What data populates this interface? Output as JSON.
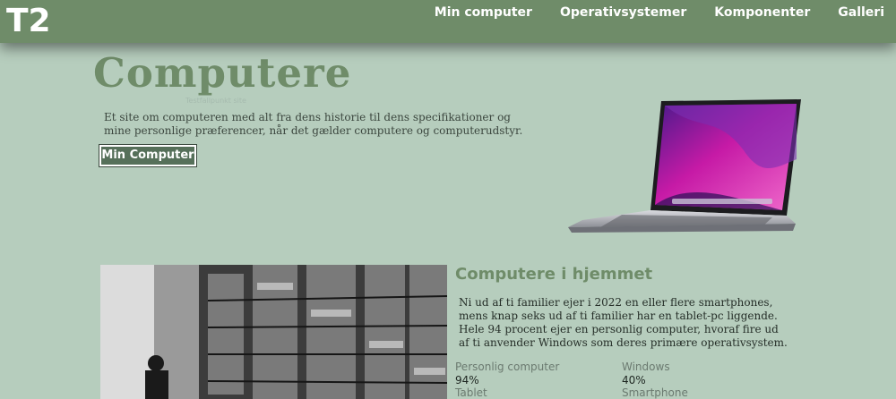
{
  "header": {
    "logo": "T2",
    "nav": [
      {
        "label": "Min computer"
      },
      {
        "label": "Operativsystemer"
      },
      {
        "label": "Komponenter"
      },
      {
        "label": "Galleri"
      }
    ]
  },
  "hero": {
    "title": "Computere",
    "subtitle_small": "Testfallpunkt site",
    "text": "Et site om computeren med alt fra dens historie til dens specifikationer og mine personlige præferencer, når det gælder computere og computerudstyr.",
    "button_label": "Min Computer"
  },
  "section": {
    "title": "Computere i hjemmet",
    "text": "Ni ud af ti familier ejer i 2022 en eller flere smartphones, mens knap seks ud af ti familier har en tablet-pc liggende. Hele 94 procent ejer en personlig computer, hvoraf fire ud af ti anvender Windows som deres primære operativsystem.",
    "stats": [
      {
        "label": "Personlig computer",
        "value": "94%"
      },
      {
        "label": "Windows",
        "value": "40%"
      },
      {
        "label": "Tablet",
        "value": ""
      },
      {
        "label": "Smartphone",
        "value": ""
      }
    ]
  },
  "colors": {
    "accent": "#6f8c69",
    "background": "#b6cdbd",
    "button": "#56705a"
  }
}
